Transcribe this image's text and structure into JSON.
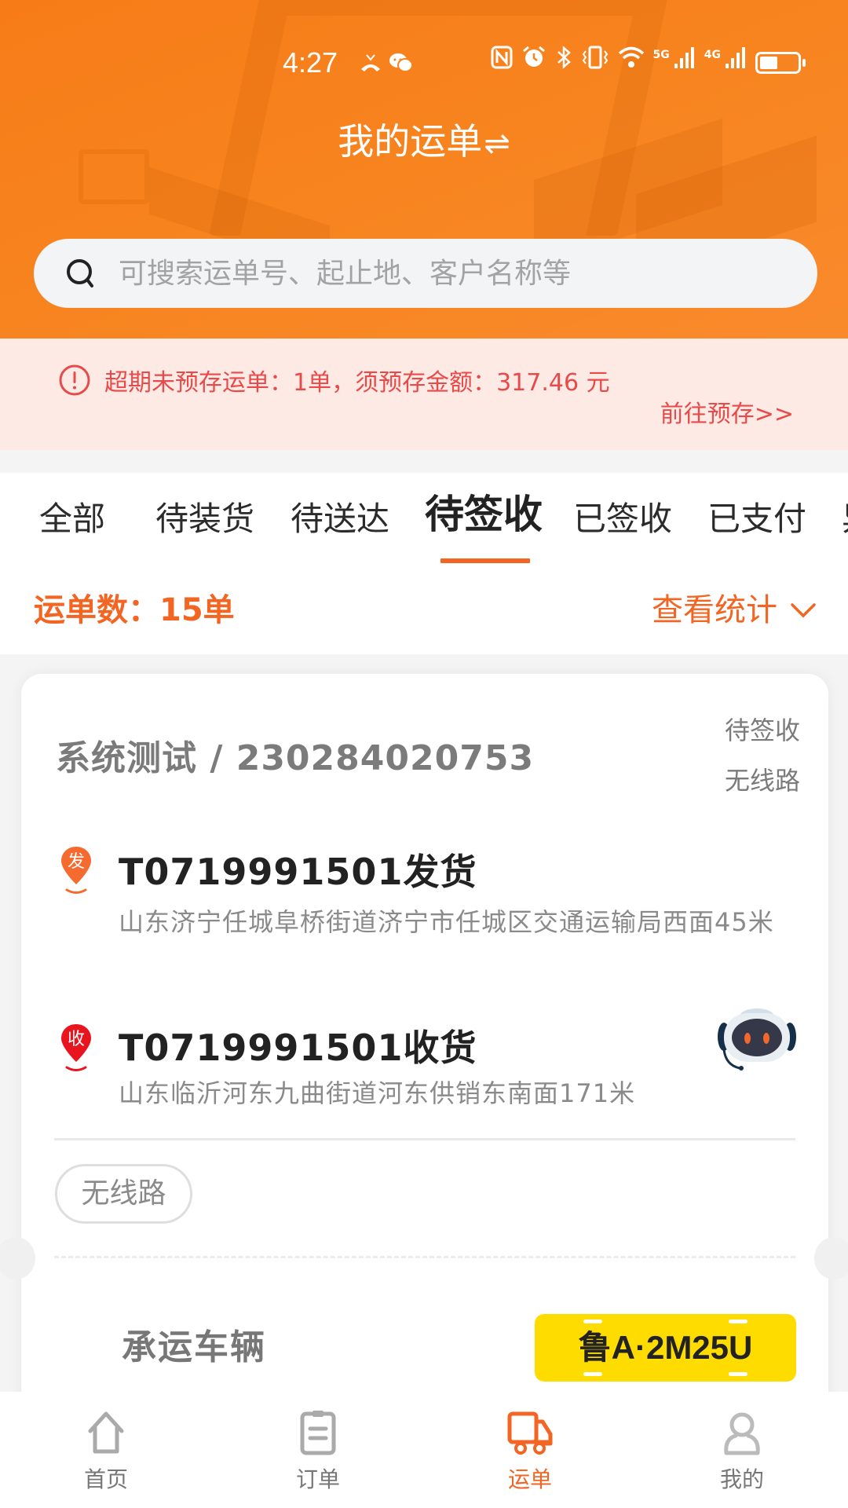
{
  "status_bar": {
    "time": "4:27",
    "left_icons": [
      "missed-call-icon",
      "wechat-icon"
    ],
    "right_icons": [
      "nfc-icon",
      "alarm-icon",
      "bluetooth-icon",
      "vibrate-icon",
      "wifi-icon",
      "signal-5g-icon",
      "signal-4g-icon",
      "battery-icon"
    ],
    "net1": "5G",
    "net2": "4G"
  },
  "header": {
    "title": "我的运单",
    "swap_icon": "⇌",
    "search_placeholder": "可搜索运单号、起止地、客户名称等",
    "search_value": ""
  },
  "alert": {
    "icon": "alert-circle-icon",
    "message": "超期未预存运单：1单，须预存金额：317.46 元",
    "overdue_count": "1单",
    "amount": "317.46 元",
    "link": "前往预存>>"
  },
  "tabs": {
    "items": [
      {
        "label": "全部"
      },
      {
        "label": "待装货"
      },
      {
        "label": "待送达"
      },
      {
        "label": "待签收"
      },
      {
        "label": "已签收"
      },
      {
        "label": "已支付"
      },
      {
        "label": "异常"
      }
    ],
    "active_index": 3
  },
  "summary": {
    "count_label": "运单数：15单",
    "stats_label": "查看统计"
  },
  "card": {
    "title": "系统测试 / 230284020753",
    "status": "待签收",
    "route_status": "无线路",
    "sender": {
      "badge": "发",
      "name": "T0719991501发货",
      "address": "山东济宁任城阜桥街道济宁市任城区交通运输局西面45米"
    },
    "receiver": {
      "badge": "收",
      "name": "T0719991501收货",
      "address": "山东临沂河东九曲街道河东供销东南面171米"
    },
    "tag": "无线路",
    "carrier_label": "承运车辆",
    "plate": "鲁A·2M25U"
  },
  "bottom_nav": {
    "items": [
      {
        "label": "首页",
        "icon": "home-icon"
      },
      {
        "label": "订单",
        "icon": "clipboard-icon"
      },
      {
        "label": "运单",
        "icon": "truck-icon"
      },
      {
        "label": "我的",
        "icon": "user-icon"
      }
    ],
    "active_index": 2
  },
  "colors": {
    "brand_orange": "#F7841F",
    "accent": "#F26522",
    "alert_red": "#E84A4A",
    "alert_bg": "#FDEAE5",
    "plate_yellow": "#FEDC00"
  }
}
